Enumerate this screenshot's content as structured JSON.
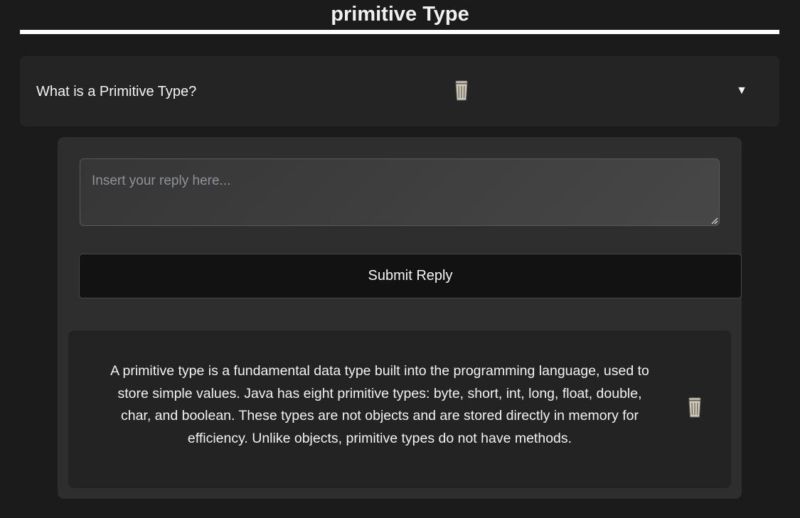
{
  "page": {
    "title": "primitive Type"
  },
  "question": {
    "text": "What is a Primitive Type?",
    "delete_icon": "trash-icon",
    "toggle_glyph": "▼"
  },
  "reply_form": {
    "placeholder": "Insert your reply here...",
    "value": "",
    "submit_label": "Submit Reply"
  },
  "replies": [
    {
      "text": "A primitive type is a fundamental data type built into the programming language, used to store simple values. Java has eight primitive types: byte, short, int, long, float, double, char, and boolean. These types are not objects and are stored directly in memory for efficiency. Unlike objects, primitive types do not have methods.",
      "delete_icon": "trash-icon"
    }
  ],
  "colors": {
    "background": "#1b1b1b",
    "card": "#242424",
    "panel": "#2e2e2e",
    "button": "#121212",
    "title_rule": "#ffffff"
  }
}
